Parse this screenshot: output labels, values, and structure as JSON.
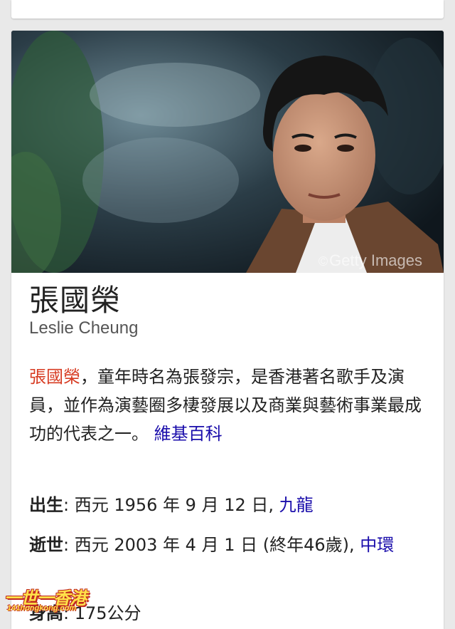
{
  "hero": {
    "watermark": "Getty Images"
  },
  "entity": {
    "title": "張國榮",
    "subtitle": "Leslie Cheung"
  },
  "description": {
    "name": "張國榮",
    "text": "，童年時名為張發宗，是香港著名歌手及演員，並作為演藝圈多棲發展以及商業與藝術事業最成功的代表之一。",
    "source_link": "維基百科"
  },
  "facts": [
    {
      "label": "出生",
      "value": ": 西元 1956 年 9 月 12 日, ",
      "link": "九龍"
    },
    {
      "label": "逝世",
      "value": ": 西元 2003 年 4 月 1 日 (終年46歲), ",
      "link": "中環"
    },
    {
      "label": "身高",
      "value": ": 175公分",
      "link": ""
    }
  ],
  "watermark_logo": {
    "line1": "一世一香港",
    "line2": "141hongkong.com"
  },
  "colors": {
    "link": "#1a0dab",
    "name_highlight": "#d73b22"
  }
}
